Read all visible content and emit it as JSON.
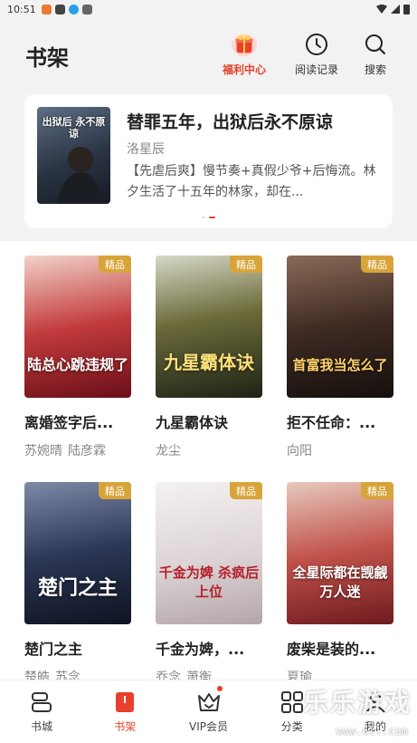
{
  "status_bar": {
    "time": "10:51"
  },
  "header": {
    "title": "书架",
    "actions": [
      {
        "label": "福利中心",
        "icon": "gift-icon"
      },
      {
        "label": "阅读记录",
        "icon": "clock-icon"
      },
      {
        "label": "搜索",
        "icon": "search-icon"
      }
    ]
  },
  "featured": {
    "title": "替罪五年，出狱后永不原谅",
    "author": "洛星辰",
    "description": "【先虐后爽】慢节奏+真假少爷+后悔流。林夕生活了十五年的林家，却在...",
    "cover_text": "出狱后 永不原谅",
    "carousel_index": 1,
    "carousel_count": 2
  },
  "books": [
    {
      "title": "离婚签字后...",
      "authors": [
        "苏婉晴",
        "陆彦霖"
      ],
      "badge": "精品",
      "cover_text": "陆总心跳违规了",
      "cover_color": "#8a1d24"
    },
    {
      "title": "九星霸体诀",
      "authors": [
        "龙尘"
      ],
      "badge": "精品",
      "cover_text": "九星霸体诀",
      "cover_color": "#3a4a2c"
    },
    {
      "title": "拒不任命：...",
      "authors": [
        "向阳"
      ],
      "badge": "精品",
      "cover_text": "首富我当怎么了",
      "cover_color": "#3b2a22"
    },
    {
      "title": "楚门之主",
      "authors": [
        "楚皓",
        "苏念"
      ],
      "badge": "精品",
      "cover_text": "楚门之主",
      "cover_color": "#1f2b45"
    },
    {
      "title": "千金为婢，...",
      "authors": [
        "乔念",
        "萧衡"
      ],
      "badge": "精品",
      "cover_text": "千金为婢 杀疯后上位",
      "cover_color": "#d9d6d8"
    },
    {
      "title": "废柴是装的...",
      "authors": [
        "夏瑜"
      ],
      "badge": "精品",
      "cover_text": "全星际都在觊觎万人迷",
      "cover_color": "#b2443e"
    }
  ],
  "bottom_nav": [
    {
      "label": "书城",
      "icon": "bookstore-icon",
      "active": false
    },
    {
      "label": "书架",
      "icon": "bookshelf-icon",
      "active": true
    },
    {
      "label": "VIP会员",
      "icon": "crown-icon",
      "active": false,
      "dot": true
    },
    {
      "label": "分类",
      "icon": "category-grid-icon",
      "active": false
    },
    {
      "label": "我的",
      "icon": "user-icon",
      "active": false
    }
  ],
  "watermark": {
    "text": "乐乐游戏",
    "url": "www.6ll.com"
  },
  "colors": {
    "accent": "#e8402a",
    "badge": "#d8a43a"
  }
}
